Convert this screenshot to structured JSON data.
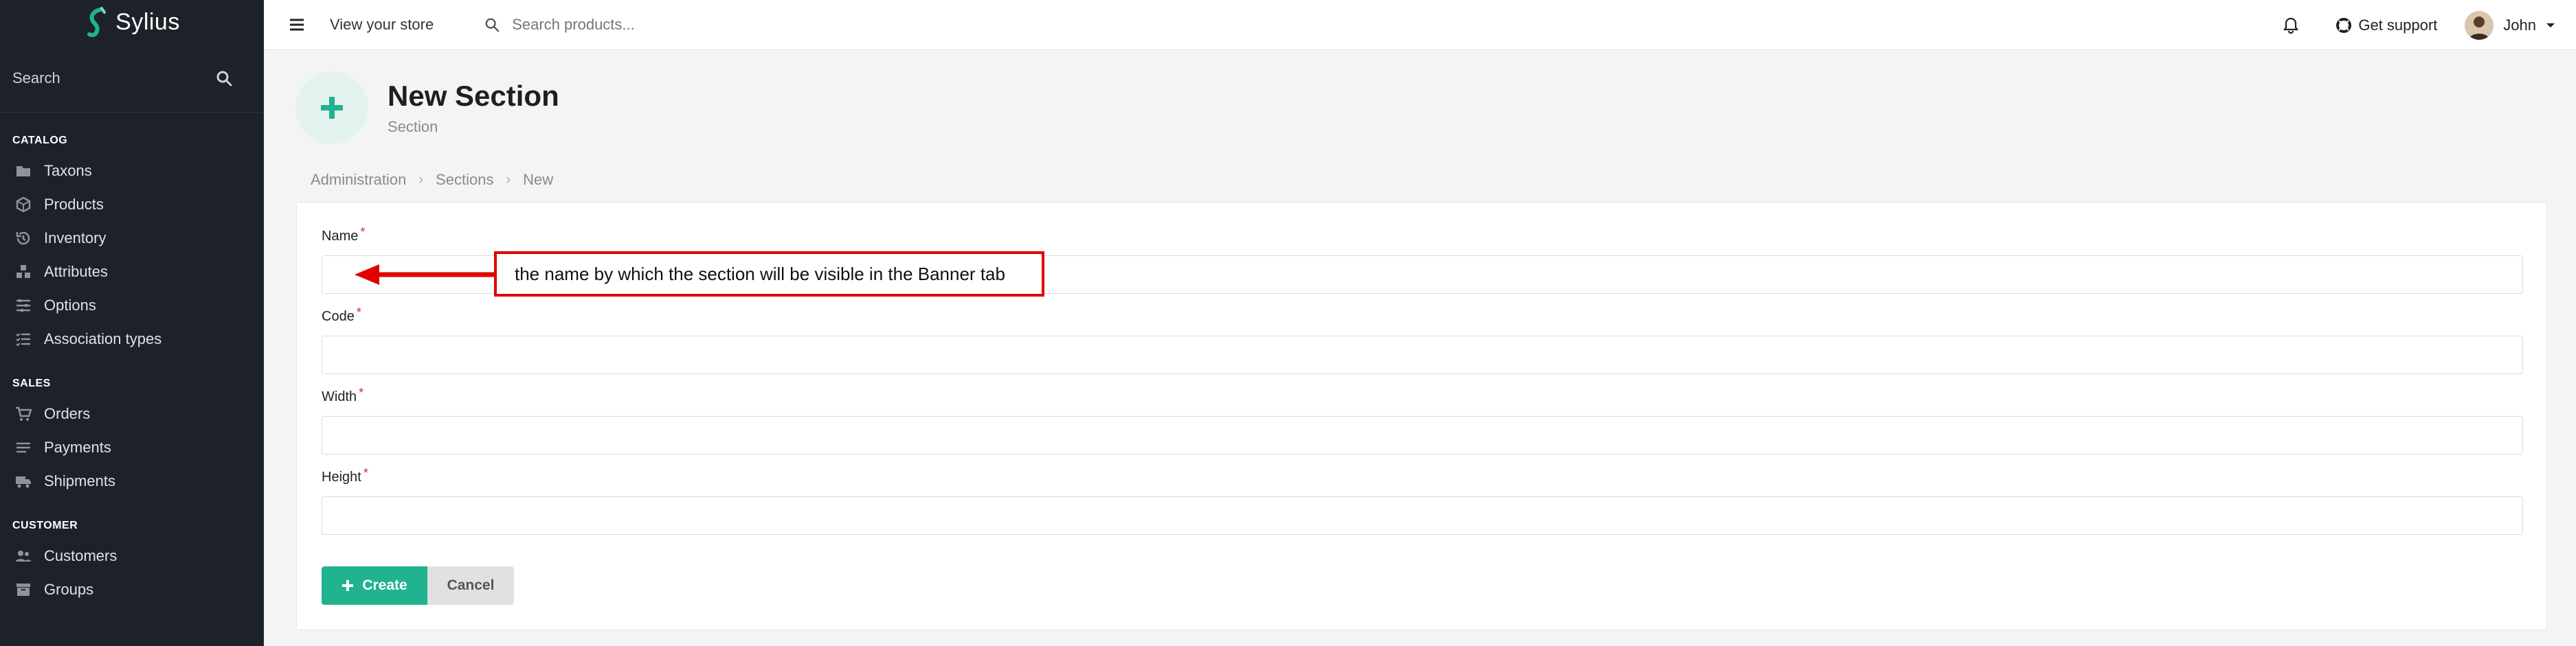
{
  "sidebar": {
    "brand": "Sylius",
    "search_label": "Search",
    "groups": [
      {
        "title": "CATALOG",
        "items": [
          {
            "label": "Taxons",
            "icon": "folder-icon"
          },
          {
            "label": "Products",
            "icon": "cube-icon"
          },
          {
            "label": "Inventory",
            "icon": "history-icon"
          },
          {
            "label": "Attributes",
            "icon": "cubes-icon"
          },
          {
            "label": "Options",
            "icon": "options-icon"
          },
          {
            "label": "Association types",
            "icon": "tasks-icon"
          }
        ]
      },
      {
        "title": "SALES",
        "items": [
          {
            "label": "Orders",
            "icon": "cart-icon"
          },
          {
            "label": "Payments",
            "icon": "payment-icon"
          },
          {
            "label": "Shipments",
            "icon": "truck-icon"
          }
        ]
      },
      {
        "title": "CUSTOMER",
        "items": [
          {
            "label": "Customers",
            "icon": "users-icon"
          },
          {
            "label": "Groups",
            "icon": "archive-icon"
          }
        ]
      }
    ]
  },
  "topbar": {
    "view_store": "View your store",
    "search_placeholder": "Search products...",
    "support": "Get support",
    "user": "John"
  },
  "header": {
    "title": "New Section",
    "subtitle": "Section"
  },
  "breadcrumb": [
    "Administration",
    "Sections",
    "New"
  ],
  "form": {
    "fields": [
      {
        "label": "Name",
        "required_mark": "*",
        "value": ""
      },
      {
        "label": "Code",
        "required_mark": "*",
        "value": ""
      },
      {
        "label": "Width",
        "required_mark": "*",
        "value": ""
      },
      {
        "label": "Height",
        "required_mark": "*",
        "value": ""
      }
    ],
    "create_label": "Create",
    "cancel_label": "Cancel"
  },
  "annotation": {
    "text": "the name by which the section will be visible in the Banner tab",
    "color": "#e00000"
  },
  "colors": {
    "accent": "#21b290",
    "sidebar_bg": "#1d222a"
  }
}
